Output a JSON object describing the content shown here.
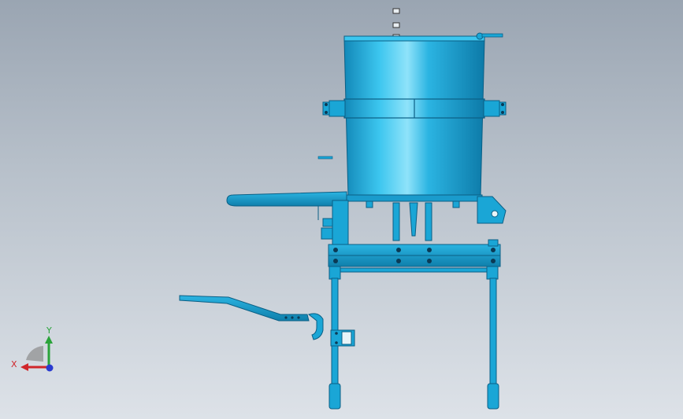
{
  "viewport": {
    "background_top": "#9aa5b2",
    "background_bottom": "#dde2e8"
  },
  "model": {
    "color_main": "#1aa6d6",
    "color_dark": "#0b5f85",
    "color_light": "#7fd7f5"
  },
  "triad": {
    "x_label": "X",
    "y_label": "Y",
    "x_color": "#d0262b",
    "y_color": "#2aa33a",
    "z_color": "#2a3bd0"
  }
}
